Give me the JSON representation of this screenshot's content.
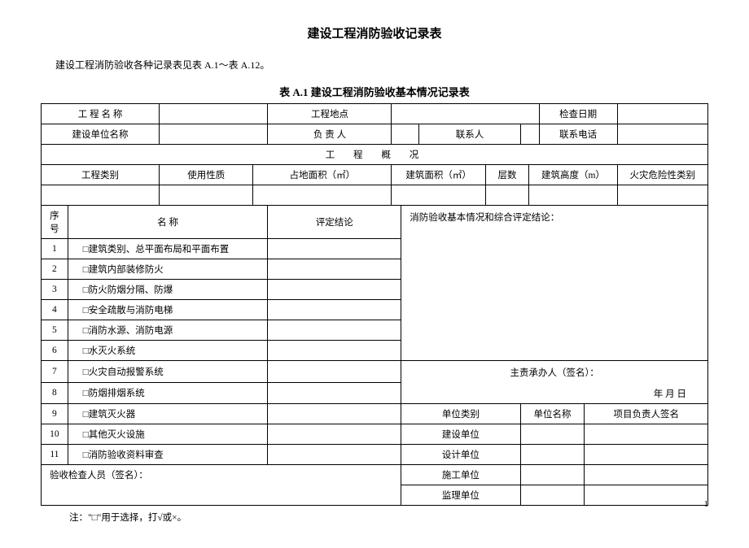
{
  "page_title": "建设工程消防验收记录表",
  "intro_text": "建设工程消防验收各种记录表见表 A.1～表 A.12。",
  "table_caption": "表 A.1 建设工程消防验收基本情况记录表",
  "row1": {
    "label1": "工 程  名 称",
    "label2": "工程地点",
    "label3": "检查日期"
  },
  "row2": {
    "label1": "建设单位名称",
    "label2": "负 责  人",
    "label3": "联系人",
    "label4": "联系电话"
  },
  "overview_header": "工 程 概 况",
  "overview_cols": {
    "c1": "工程类别",
    "c2": "使用性质",
    "c3": "占地面积（㎡）",
    "c4": "建筑面积（㎡）",
    "c5": "层数",
    "c6": "建筑高度（m）",
    "c7": "火灾危险性类别"
  },
  "list_header": {
    "h1": "序号",
    "h2": "名 称",
    "h3": "评定结论"
  },
  "rows": [
    {
      "num": "1",
      "name": "□建筑类别、总平面布局和平面布置"
    },
    {
      "num": "2",
      "name": "□建筑内部装修防火"
    },
    {
      "num": "3",
      "name": "□防火防烟分隔、防爆"
    },
    {
      "num": "4",
      "name": "□安全疏散与消防电梯"
    },
    {
      "num": "5",
      "name": "□消防水源、消防电源"
    },
    {
      "num": "6",
      "name": "□水灭火系统"
    },
    {
      "num": "7",
      "name": "□火灾自动报警系统"
    },
    {
      "num": "8",
      "name": "□防烟排烟系统"
    },
    {
      "num": "9",
      "name": "□建筑灭火器"
    },
    {
      "num": "10",
      "name": "□其他灭火设施"
    },
    {
      "num": "11",
      "name": "□消防验收资料审查"
    }
  ],
  "conclusion_label": "消防验收基本情况和综合评定结论：",
  "signer_label": "主责承办人（签名）：",
  "date_label": "年   月   日",
  "unit_header": {
    "h1": "单位类别",
    "h2": "单位名称",
    "h3": "项目负责人签名"
  },
  "units": {
    "u1": "建设单位",
    "u2": "设计单位",
    "u3": "施工单位",
    "u4": "监理单位"
  },
  "inspector_sign": "验收检查人员（签名）：",
  "footnote": "注：\"□\"用于选择，打√或×。",
  "page_number": "1"
}
